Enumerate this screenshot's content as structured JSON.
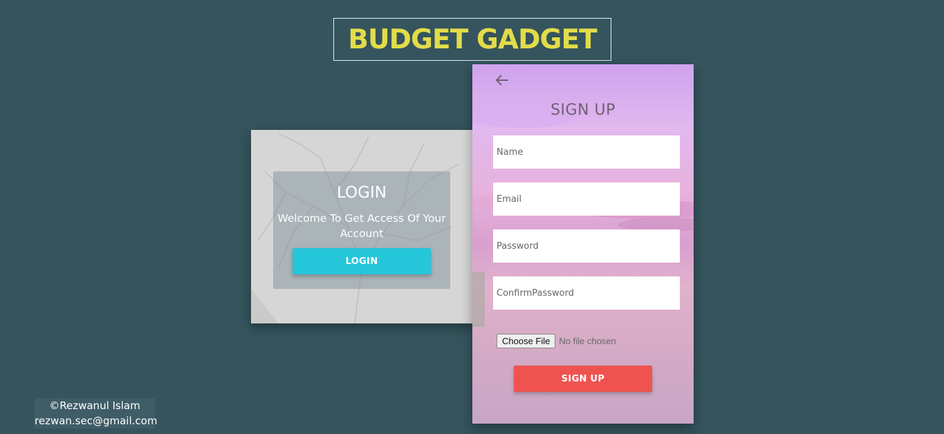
{
  "header": {
    "title": "BUDGET GADGET"
  },
  "login": {
    "heading": "LOGIN",
    "welcome": "Welcome To Get Access Of Your Account",
    "button_label": "LOGIN"
  },
  "signup": {
    "heading": "SIGN UP",
    "back_icon": "arrow-left-icon",
    "fields": {
      "name": {
        "placeholder": "Name",
        "value": ""
      },
      "email": {
        "placeholder": "Email",
        "value": ""
      },
      "password": {
        "placeholder": "Password",
        "value": ""
      },
      "confirm_password": {
        "placeholder": "ConfirmPassword",
        "value": ""
      }
    },
    "file_button_label": "Choose File",
    "file_status": "No file chosen",
    "button_label": "SIGN UP"
  },
  "footer": {
    "author": "©Rezwanul Islam",
    "email": "rezwan.sec@gmail.com"
  },
  "colors": {
    "background": "#35545d",
    "title": "#e2dc4a",
    "login_button": "#26c6da",
    "signup_button": "#ef5350"
  }
}
